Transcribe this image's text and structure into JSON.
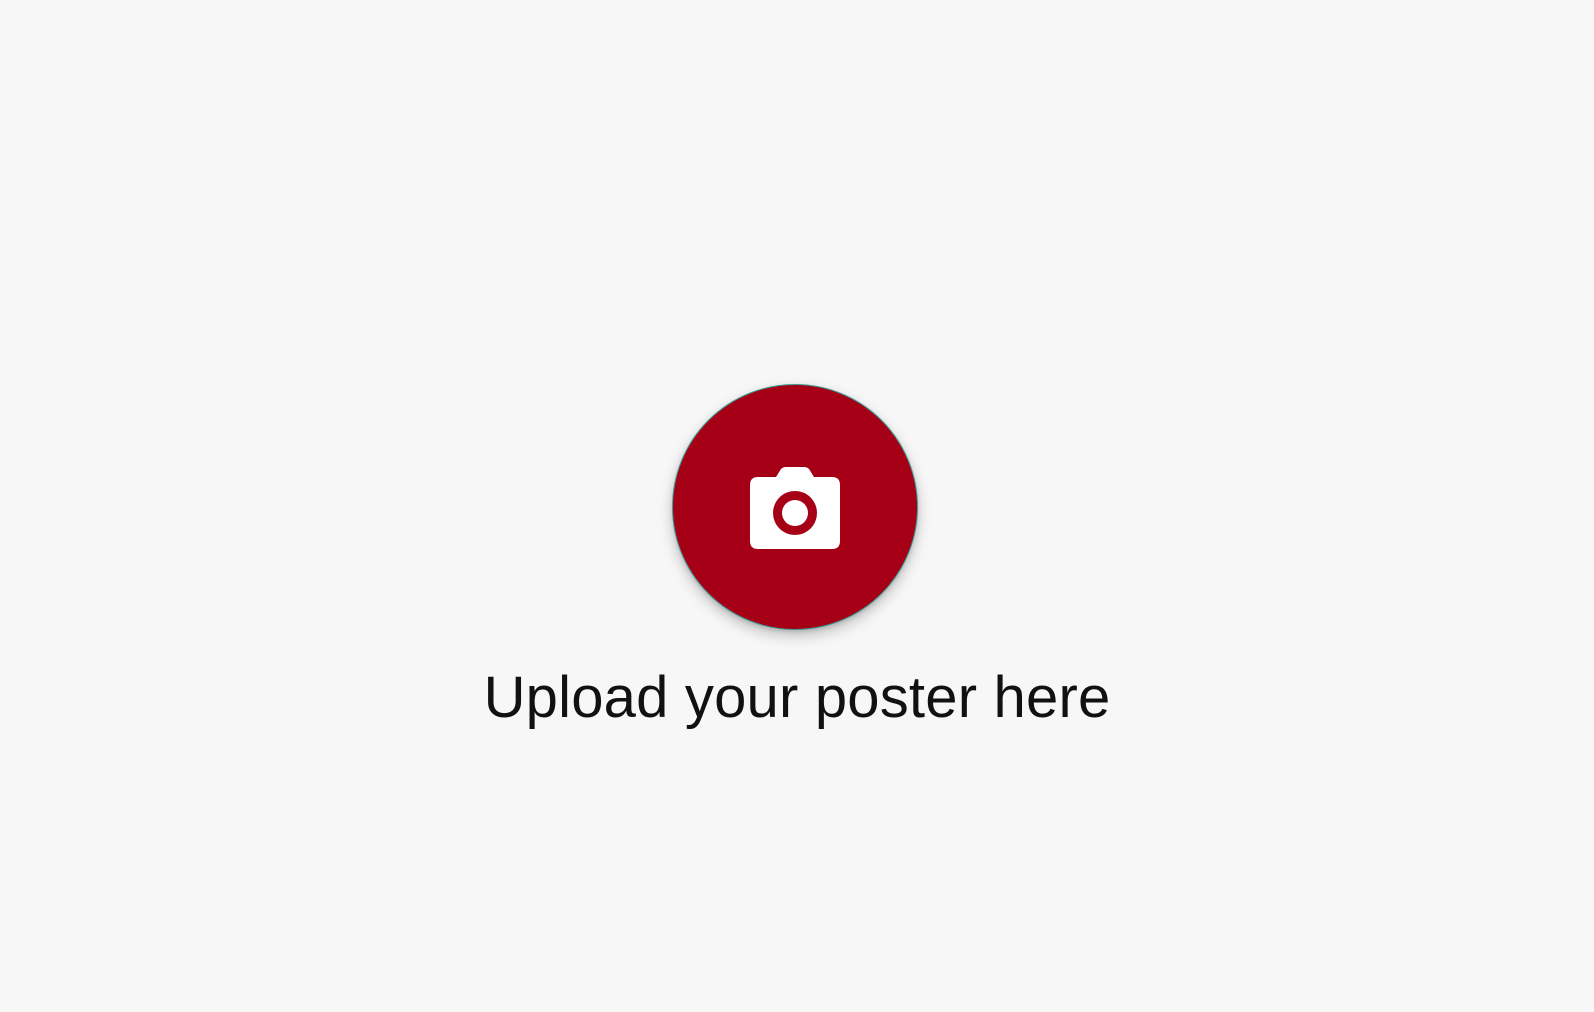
{
  "upload": {
    "label": "Upload your poster here",
    "icon": "camera-icon"
  },
  "colors": {
    "background": "#f7f7f7",
    "button_fill": "#a50016",
    "button_border": "#3b9c95",
    "icon": "#ffffff",
    "text": "#111111"
  }
}
